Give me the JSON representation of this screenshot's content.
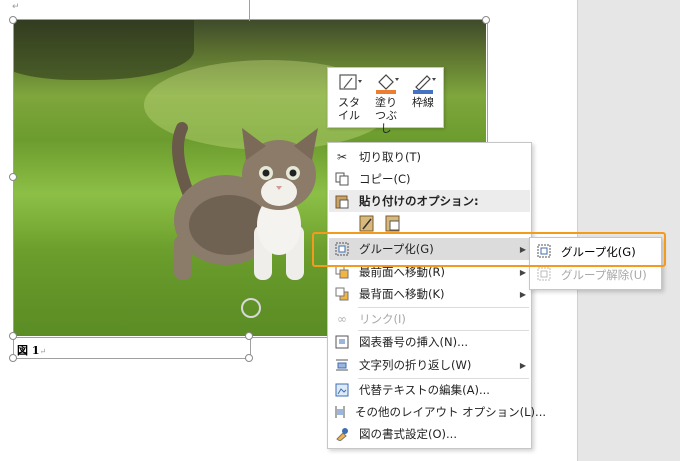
{
  "document": {
    "caption_prefix": "図 1",
    "paragraph_mark": "↵"
  },
  "mini_toolbar": {
    "style_label": "スタイル",
    "fill_label": "塗りつぶし",
    "outline_label": "枠線"
  },
  "context_menu": {
    "items": [
      {
        "label": "切り取り(T)",
        "icon": "scissors-icon"
      },
      {
        "label": "コピー(C)",
        "icon": "copy-icon"
      },
      {
        "label": "貼り付けのオプション:",
        "icon": "paste-icon"
      },
      {
        "label": "グループ化(G)",
        "icon": "group-icon"
      },
      {
        "label": "最前面へ移動(R)",
        "icon": "bring-to-front-icon"
      },
      {
        "label": "最背面へ移動(K)",
        "icon": "send-to-back-icon"
      },
      {
        "label": "リンク(I)",
        "icon": "link-icon"
      },
      {
        "label": "図表番号の挿入(N)...",
        "icon": "insert-caption-icon"
      },
      {
        "label": "文字列の折り返し(W)",
        "icon": "wrap-text-icon"
      },
      {
        "label": "代替テキストの編集(A)...",
        "icon": "alt-text-icon"
      },
      {
        "label": "その他のレイアウト オプション(L)...",
        "icon": "layout-options-icon"
      },
      {
        "label": "図の書式設定(O)...",
        "icon": "format-picture-icon"
      }
    ]
  },
  "submenu": {
    "items": [
      {
        "label": "グループ化(G)",
        "icon": "group-icon",
        "enabled": true
      },
      {
        "label": "グループ解除(U)",
        "icon": "ungroup-icon",
        "enabled": false
      }
    ]
  },
  "colors": {
    "highlight_border": "#f39a1f",
    "fill_color": "#ed7d31",
    "outline_color": "#4472c4"
  }
}
